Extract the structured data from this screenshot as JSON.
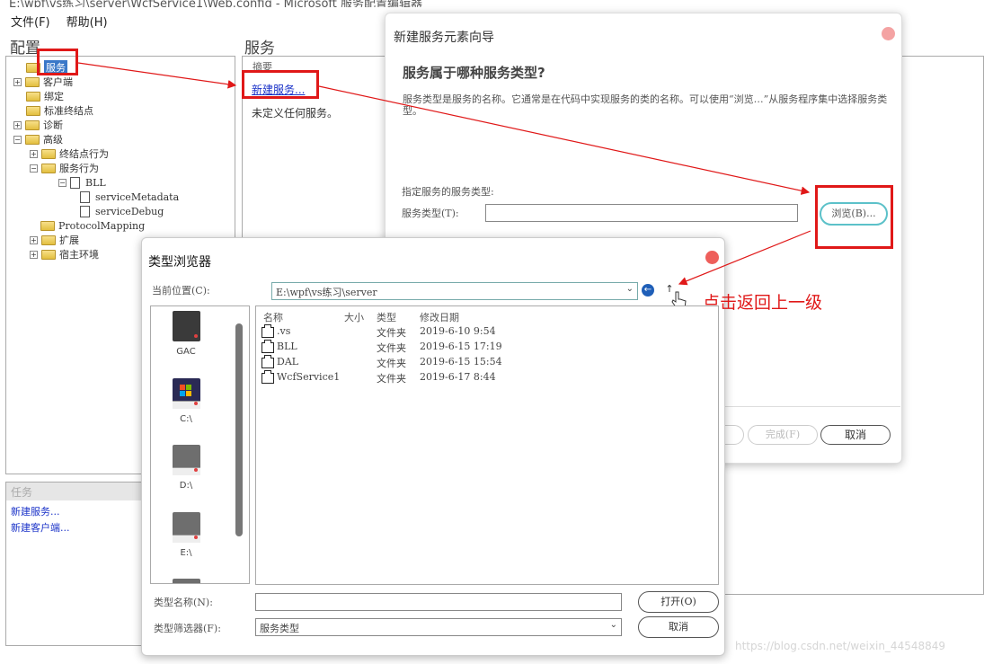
{
  "window": {
    "title": "E:\\wpf\\vs练习\\server\\WcfService1\\Web.config - Microsoft 服务配置编辑器"
  },
  "menu": [
    {
      "label": "文件(F)"
    },
    {
      "label": "帮助(H)"
    }
  ],
  "config_panel": {
    "heading": "配置",
    "tree": [
      {
        "label": "服务",
        "selected": true
      },
      {
        "label": "客户端"
      },
      {
        "label": "绑定"
      },
      {
        "label": "标准终结点"
      },
      {
        "label": "诊断"
      },
      {
        "label": "高级"
      },
      {
        "label": "终结点行为"
      },
      {
        "label": "服务行为"
      },
      {
        "label": "BLL"
      },
      {
        "label": "serviceMetadata"
      },
      {
        "label": "serviceDebug"
      },
      {
        "label": "ProtocolMapping"
      },
      {
        "label": "扩展"
      },
      {
        "label": "宿主环境"
      }
    ]
  },
  "tasks_panel": {
    "heading": "任务",
    "links": [
      {
        "label": "新建服务..."
      },
      {
        "label": "新建客户端..."
      }
    ]
  },
  "services_panel": {
    "heading": "服务",
    "summary_label": "摘要",
    "new_service_link": "新建服务...",
    "empty_text": "未定义任何服务。"
  },
  "wizard": {
    "title": "新建服务元素向导",
    "question": "服务属于哪种服务类型?",
    "description": "服务类型是服务的名称。它通常是在代码中实现服务的类的名称。可以使用“浏览…”从服务程序集中选择服务类型。",
    "specify_label": "指定服务的服务类型:",
    "type_label": "服务类型(T):",
    "type_value": "",
    "browse_label": "浏览(B)...",
    "finish_label": "完成(F)",
    "cancel_label": "取消"
  },
  "type_browser": {
    "title": "类型浏览器",
    "location_label": "当前位置(C):",
    "location_value": "E:\\wpf\\vs练习\\server",
    "places": [
      {
        "label": "GAC",
        "icon": "gac-icon"
      },
      {
        "label": "C:\\",
        "icon": "windows-drive-icon"
      },
      {
        "label": "D:\\",
        "icon": "drive-icon"
      },
      {
        "label": "E:\\",
        "icon": "drive-icon"
      }
    ],
    "columns": {
      "name": "名称",
      "size": "大小",
      "type": "类型",
      "modified": "修改日期"
    },
    "files": [
      {
        "name": ".vs",
        "size": "",
        "type": "文件夹",
        "modified": "2019-6-10 9:54"
      },
      {
        "name": "BLL",
        "size": "",
        "type": "文件夹",
        "modified": "2019-6-15 17:19"
      },
      {
        "name": "DAL",
        "size": "",
        "type": "文件夹",
        "modified": "2019-6-15 15:54"
      },
      {
        "name": "WcfService1",
        "size": "",
        "type": "文件夹",
        "modified": "2019-6-17 8:44"
      }
    ],
    "type_name_label": "类型名称(N):",
    "type_name_value": "",
    "type_filter_label": "类型筛选器(F):",
    "type_filter_value": "服务类型",
    "open_label": "打开(O)",
    "cancel_label": "取消"
  },
  "annotation": {
    "text": "点击返回上一级",
    "color": "#e01818"
  },
  "watermark": "https://blog.csdn.net/weixin_44548849"
}
